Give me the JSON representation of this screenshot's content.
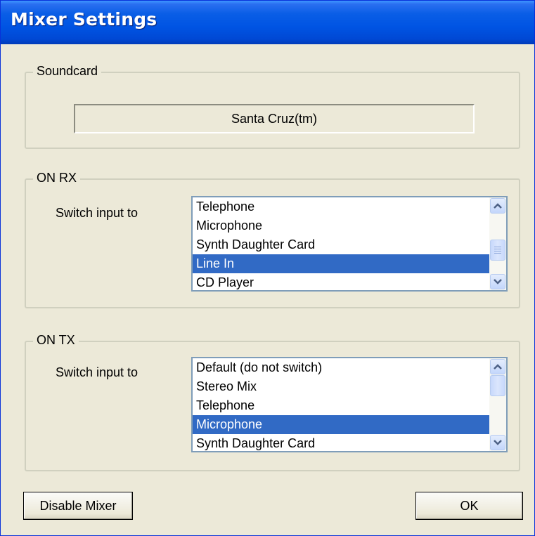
{
  "window": {
    "title": "Mixer Settings"
  },
  "soundcard": {
    "legend": "Soundcard",
    "value": "Santa Cruz(tm)"
  },
  "rx": {
    "legend": "ON RX",
    "label": "Switch input to",
    "items": [
      "Telephone",
      "Microphone",
      "Synth Daughter Card",
      "Line In",
      "CD Player"
    ],
    "selected": "Line In"
  },
  "tx": {
    "legend": "ON TX",
    "label": "Switch input to",
    "items": [
      "Default (do not switch)",
      "Stereo Mix",
      "Telephone",
      "Microphone",
      "Synth Daughter Card"
    ],
    "selected": "Microphone"
  },
  "buttons": {
    "disable_mixer": "Disable Mixer",
    "ok": "OK"
  },
  "colors": {
    "titlebar": "#0054e3",
    "selection": "#316ac5",
    "dialog_bg": "#ece9d8"
  },
  "icons": {
    "scroll_up": "chevron-up-icon",
    "scroll_down": "chevron-down-icon"
  }
}
